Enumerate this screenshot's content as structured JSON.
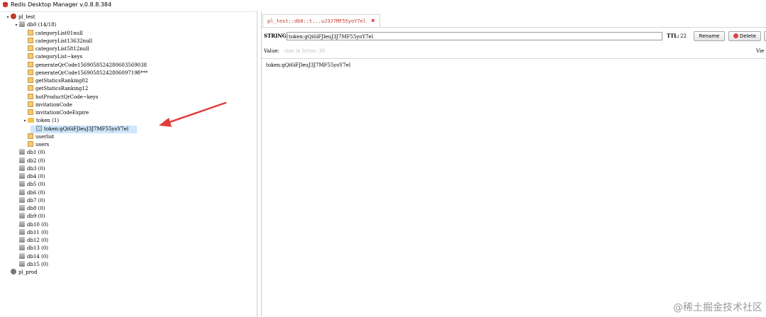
{
  "window": {
    "title": "Redis Desktop Manager v.0.8.8.384"
  },
  "tree": [
    {
      "label": "pl_test",
      "icon": "server-connected-icon",
      "expanded": true
    },
    {
      "label": "db0  (14/18)",
      "icon": "database-icon",
      "expanded": true
    },
    {
      "label": "categoryList01null",
      "icon": "key-icon"
    },
    {
      "label": "categoryList13632null",
      "icon": "key-icon"
    },
    {
      "label": "categoryList5812null",
      "icon": "key-icon"
    },
    {
      "label": "categoryList~keys",
      "icon": "key-icon"
    },
    {
      "label": "generateQrCode1569058524280603569038",
      "icon": "key-icon"
    },
    {
      "label": "generateQrCode1569058524280609719б***",
      "icon": "key-icon"
    },
    {
      "label": "getStaticsRanking02",
      "icon": "key-icon"
    },
    {
      "label": "getStaticsRanking12",
      "icon": "key-icon"
    },
    {
      "label": "hotProductQrCode~keys",
      "icon": "key-icon"
    },
    {
      "label": "invitationCode",
      "icon": "key-icon"
    },
    {
      "label": "invitationCodeExpire",
      "icon": "key-icon"
    },
    {
      "label": "token (1)",
      "icon": "folder-icon",
      "expanded": true
    },
    {
      "label": "token:gQi6iFJleuJ3J7MF55yoY7el",
      "icon": "key-icon",
      "selected": true
    },
    {
      "label": "userlist",
      "icon": "key-icon"
    },
    {
      "label": "users",
      "icon": "key-icon"
    },
    {
      "label": "db1 (0)",
      "icon": "database-icon"
    },
    {
      "label": "db2 (0)",
      "icon": "database-icon"
    },
    {
      "label": "db3 (0)",
      "icon": "database-icon"
    },
    {
      "label": "db4 (0)",
      "icon": "database-icon"
    },
    {
      "label": "db5 (0)",
      "icon": "database-icon"
    },
    {
      "label": "db6 (0)",
      "icon": "database-icon"
    },
    {
      "label": "db7 (0)",
      "icon": "database-icon"
    },
    {
      "label": "db8 (0)",
      "icon": "database-icon"
    },
    {
      "label": "db9 (0)",
      "icon": "database-icon"
    },
    {
      "label": "db10 (0)",
      "icon": "database-icon"
    },
    {
      "label": "db11 (0)",
      "icon": "database-icon"
    },
    {
      "label": "db12 (0)",
      "icon": "database-icon"
    },
    {
      "label": "db13 (0)",
      "icon": "database-icon"
    },
    {
      "label": "db14 (0)",
      "icon": "database-icon"
    },
    {
      "label": "db15 (0)",
      "icon": "database-icon"
    },
    {
      "label": "pl_prod",
      "icon": "server-icon"
    }
  ],
  "tab": {
    "label": "pl_test::db0::t...uJ3J7MF55yoY7el",
    "close": "✖"
  },
  "editor": {
    "type_label": "STRING:",
    "key_value": "token:gQi6iFJleuJ3J7MF55yoY7el",
    "ttl_label": "TTL:",
    "ttl_value": "22",
    "rename_label": "Rename",
    "delete_label": "Delete",
    "value_label": "Value:",
    "value_size": "size in bytes: 30",
    "view_label": "Vie",
    "value_text": "token:gQi6iFJleuJ3J7MF55yoY7el"
  },
  "watermark": "@稀土掘金技术社区",
  "colors": {
    "accent_red": "#c0392b",
    "selection": "#cfe6fb",
    "annotation_arrow": "#e23b3b"
  }
}
